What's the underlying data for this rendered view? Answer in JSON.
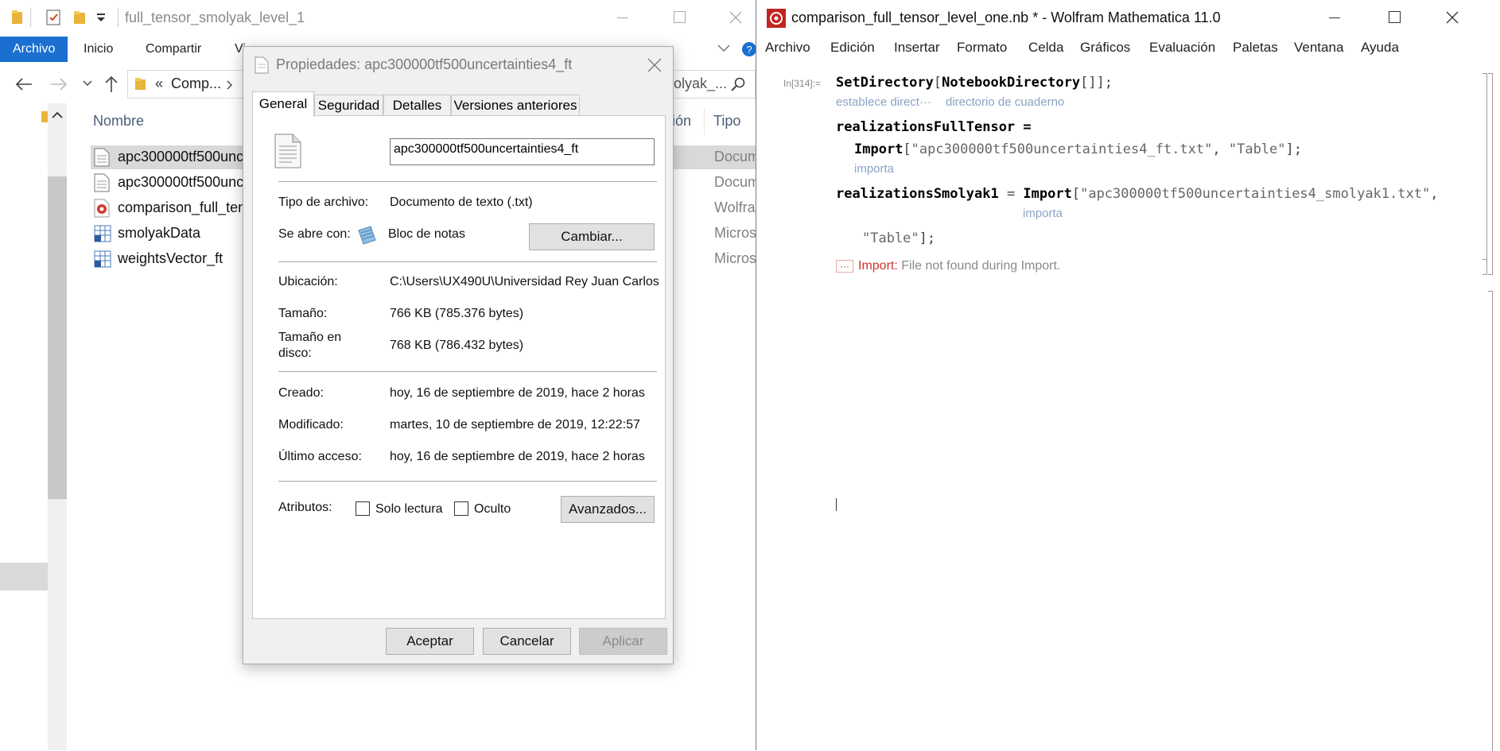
{
  "explorer": {
    "title": "full_tensor_smolyak_level_1",
    "ribbon_tabs": [
      "Archivo",
      "Inicio",
      "Compartir",
      "Vista"
    ],
    "ribbon_partial": "Vi",
    "address": {
      "prefix": "«",
      "text": "Comp...",
      "search_text": "olyak_..."
    },
    "columns": {
      "name": "Nombre",
      "date_partial": "ión",
      "type": "Tipo"
    },
    "files": [
      {
        "name": "apc300000tf500unc",
        "type": "Docum",
        "icon": "text-file-icon",
        "selected": true
      },
      {
        "name": "apc300000tf500unc",
        "type": "Docum",
        "icon": "text-file-icon",
        "selected": false
      },
      {
        "name": "comparison_full_ten",
        "type": "Wolfra",
        "icon": "mathematica-notebook-icon",
        "selected": false
      },
      {
        "name": "smolyakData",
        "type": "Micros",
        "icon": "table-file-icon",
        "selected": false
      },
      {
        "name": "weightsVector_ft",
        "type": "Micros",
        "icon": "table-file-icon",
        "selected": false
      }
    ]
  },
  "dialog": {
    "title": "Propiedades: apc300000tf500uncertainties4_ft",
    "tabs": [
      "General",
      "Seguridad",
      "Detalles",
      "Versiones anteriores"
    ],
    "filename": "apc300000tf500uncertainties4_ft",
    "rows": {
      "tipo_label": "Tipo de archivo:",
      "tipo_value": "Documento de texto (.txt)",
      "abre_label": "Se abre con:",
      "abre_value": "Bloc de notas",
      "cambiar": "Cambiar...",
      "ubicacion_label": "Ubicación:",
      "ubicacion_value": "C:\\Users\\UX490U\\Universidad Rey Juan Carlos",
      "tamano_label": "Tamaño:",
      "tamano_value": "766 KB (785.376 bytes)",
      "tamano_disco_label_1": "Tamaño en",
      "tamano_disco_label_2": "disco:",
      "tamano_disco_value": "768 KB (786.432 bytes)",
      "creado_label": "Creado:",
      "creado_value": "hoy, 16 de septiembre de 2019, hace 2 horas",
      "modificado_label": "Modificado:",
      "modificado_value": "martes, 10 de septiembre de 2019, 12:22:57",
      "acceso_label": "Último acceso:",
      "acceso_value": "hoy, 16 de septiembre de 2019, hace 2 horas",
      "atributos_label": "Atributos:",
      "solo_lectura": "Solo lectura",
      "oculto": "Oculto",
      "avanzados": "Avanzados..."
    },
    "buttons": {
      "ok": "Aceptar",
      "cancel": "Cancelar",
      "apply": "Aplicar"
    }
  },
  "mathematica": {
    "title": "comparison_full_tensor_level_one.nb * - Wolfram Mathematica 11.0",
    "menu": [
      "Archivo",
      "Edición",
      "Insertar",
      "Formato",
      "Celda",
      "Gráficos",
      "Evaluación",
      "Paletas",
      "Ventana",
      "Ayuda"
    ],
    "in_label": "In[314]:=",
    "line1": {
      "fn": "SetDirectory",
      "open": "[",
      "arg": "NotebookDirectory",
      "args": "[]",
      "close": "];"
    },
    "tip1a": "establece direct···",
    "tip1b": "directorio de cuaderno",
    "line2": "realizationsFullTensor =",
    "line3": {
      "fn": "Import",
      "open": "[",
      "str1": "\"apc300000tf500uncertainties4_ft.txt\"",
      "comma": ", ",
      "str2": "\"Table\"",
      "close": "];"
    },
    "tip3": "importa",
    "line4": {
      "var": "realizationsSmolyak1",
      "eq": " = ",
      "fn": "Import",
      "open": "[",
      "str1": "\"apc300000tf500uncertainties4_smolyak1.txt\"",
      "comma": ","
    },
    "tip4": "importa",
    "line5": {
      "str2": "\"Table\"",
      "close": "];"
    },
    "message": {
      "dots": "···",
      "head": "Import:",
      "text": " File not found during Import."
    }
  },
  "colors": {
    "ribbon_active": "#1a6fd0",
    "mma_red": "#c0261f",
    "tooltip": "#8aa3c4",
    "error": "#d2322d"
  }
}
